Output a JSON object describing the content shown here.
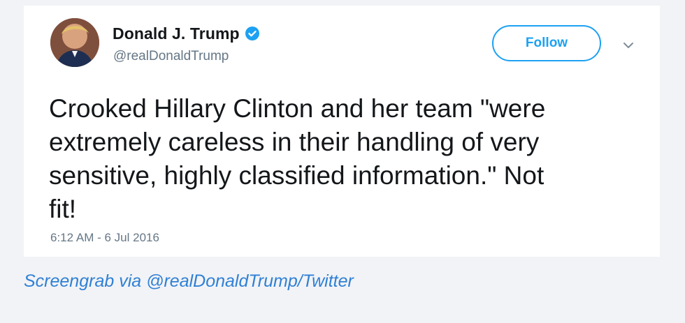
{
  "tweet": {
    "display_name": "Donald J. Trump",
    "handle": "@realDonaldTrump",
    "follow_label": "Follow",
    "text": "Crooked Hillary Clinton and her team \"were\nextremely careless in their handling of very\nsensitive, highly classified information.\" Not\nfit!",
    "timestamp": "6:12 AM - 6 Jul 2016",
    "icons": {
      "verified": "verified-badge-icon",
      "more": "chevron-down-icon"
    }
  },
  "caption": "Screengrab via @realDonaldTrump/Twitter",
  "colors": {
    "accent": "#1da1f2",
    "caption": "#2f80d5",
    "background": "#f2f3f6",
    "card": "#ffffff"
  }
}
